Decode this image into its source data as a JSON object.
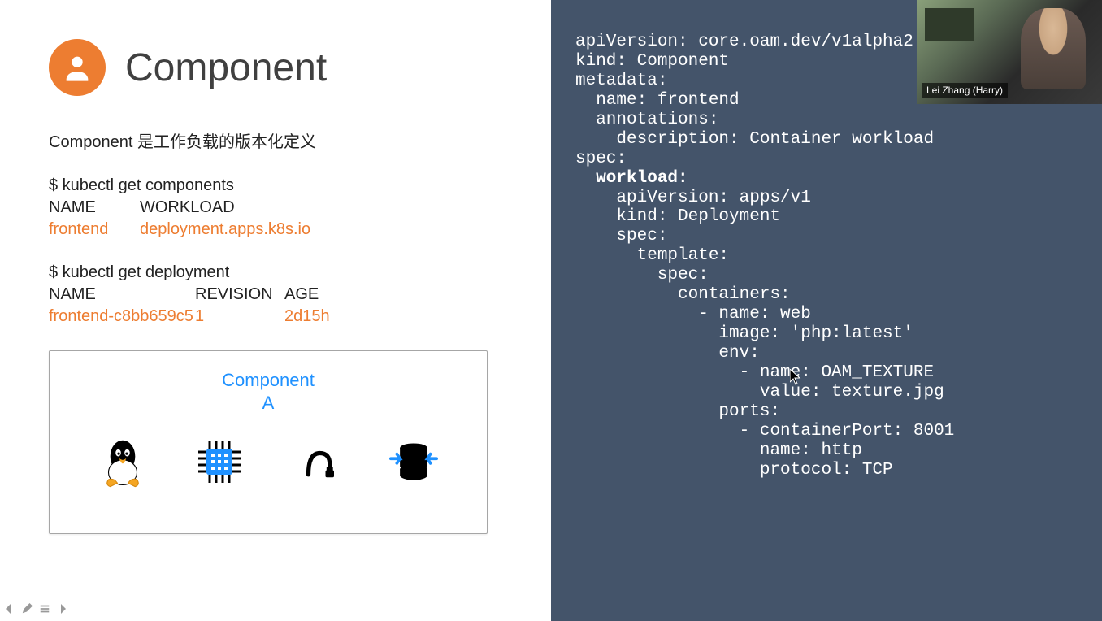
{
  "slide": {
    "title": "Component",
    "description": "Component 是工作负载的版本化定义",
    "cmd1": "$ kubectl get components",
    "table1": {
      "headers": [
        "NAME",
        "WORKLOAD"
      ],
      "row": [
        "frontend",
        "deployment.apps.k8s.io"
      ]
    },
    "cmd2": "$ kubectl get deployment",
    "table2": {
      "headers": [
        "NAME",
        "REVISION",
        "AGE"
      ],
      "row": [
        "frontend-c8bb659c5",
        "1",
        "2d15h"
      ]
    },
    "component_box": {
      "label_line1": "Component",
      "label_line2": "A"
    }
  },
  "yaml": {
    "l1": "apiVersion: core.oam.dev/v1alpha2",
    "l2": "kind: Component",
    "l3": "metadata:",
    "l4": "  name: frontend",
    "l5": "  annotations:",
    "l6": "    description: Container workload",
    "l7": "spec:",
    "l8": "  workload:",
    "l9": "    apiVersion: apps/v1",
    "l10": "    kind: Deployment",
    "l11": "    spec:",
    "l12": "      template:",
    "l13": "        spec:",
    "l14": "          containers:",
    "l15": "            - name: web",
    "l16": "              image: 'php:latest'",
    "l17": "              env:",
    "l18": "                - name: OAM_TEXTURE",
    "l19": "                  value: texture.jpg",
    "l20": "              ports:",
    "l21": "                - containerPort: 8001",
    "l22": "                  name: http",
    "l23": "                  protocol: TCP"
  },
  "webcam": {
    "name": "Lei Zhang (Harry)"
  }
}
